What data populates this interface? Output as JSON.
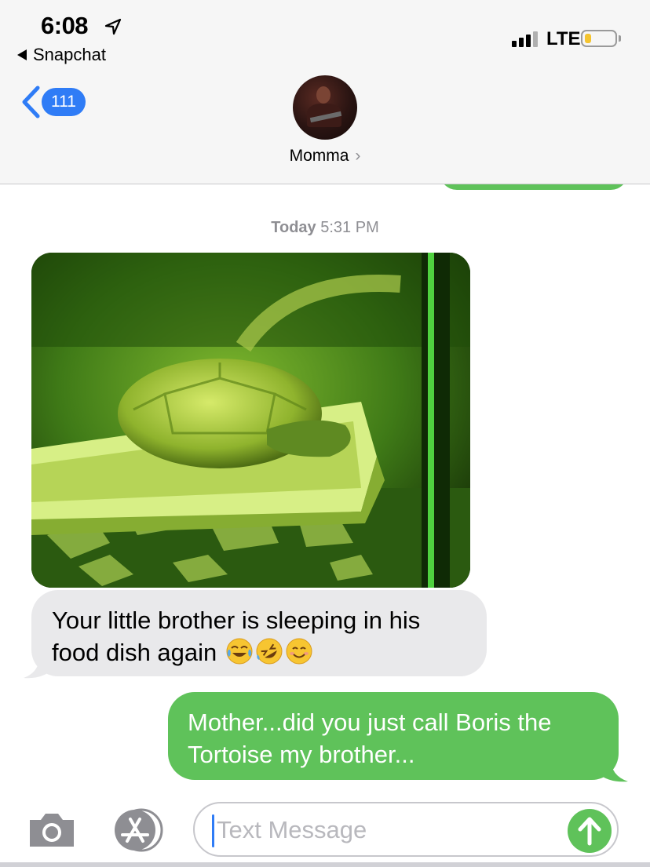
{
  "status_bar": {
    "time": "6:08",
    "back_app": "Snapchat",
    "network": "LTE",
    "battery_level": 0.2
  },
  "header": {
    "unread_count": "111",
    "contact_name": "Momma",
    "contact_chevron": "›"
  },
  "conversation": {
    "timestamp_day": "Today",
    "timestamp_time": "5:31 PM",
    "photo_icon": "tortoise-photo",
    "incoming_message": "Your little brother is sleeping in his food dish again",
    "incoming_emoji": [
      "face-with-tears-of-joy",
      "rolling-on-floor-laughing",
      "smiling-face"
    ],
    "outgoing_message": "Mother...did you just call Boris the Tortoise my brother..."
  },
  "input_bar": {
    "placeholder": "Text Message",
    "camera_icon": "camera-icon",
    "apps_icon": "app-store-icon",
    "send_icon": "send-arrow-icon"
  },
  "colors": {
    "imessage_blue": "#2f7cf6",
    "sms_green": "#5fc25a",
    "incoming_gray": "#e9e9eb"
  }
}
